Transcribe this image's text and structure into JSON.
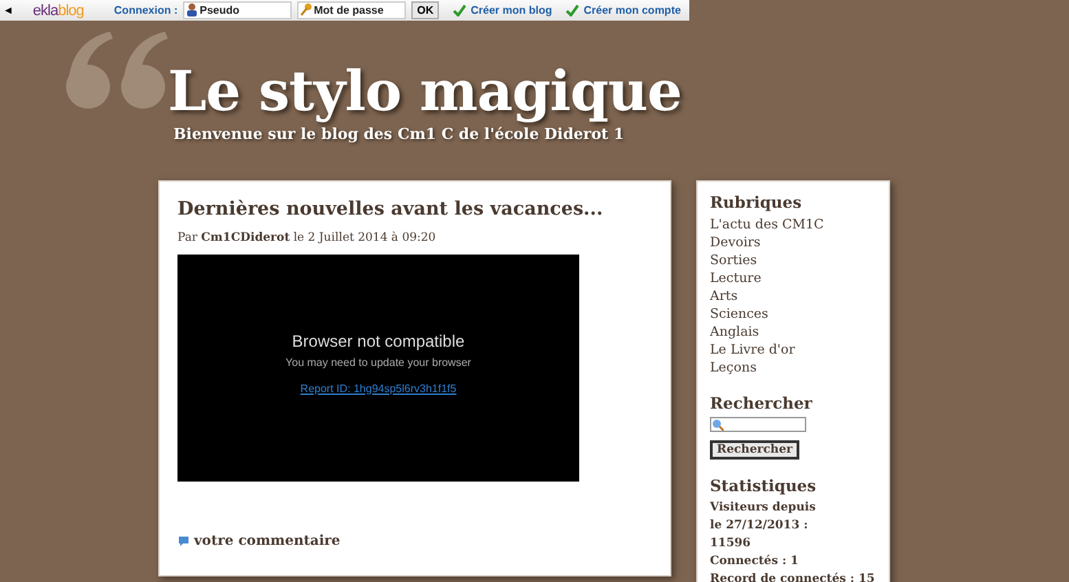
{
  "topbar": {
    "back": "◄",
    "logo": [
      "ekla",
      "blog"
    ],
    "login_label": "Connexion :",
    "pseudo": {
      "placeholder": "Pseudo"
    },
    "password": {
      "placeholder": "Mot de passe"
    },
    "ok": "OK",
    "links": [
      "Créer mon blog",
      "Créer mon compte"
    ]
  },
  "header": {
    "title": "Le stylo magique",
    "subtitle": "Bienvenue sur le blog des Cm1 C de l'école Diderot 1"
  },
  "post": {
    "title": "Dernières nouvelles avant les vacances...",
    "by": "Par",
    "author": "Cm1CDiderot",
    "date": "le 2 Juillet 2014 à 09:20",
    "video": {
      "heading": "Browser not compatible",
      "message": "You may need to update your browser",
      "report": "Report ID: 1hg94sp5l6rv3h1f1f5"
    },
    "comment": "votre commentaire"
  },
  "sidebar": {
    "rubriques": {
      "title": "Rubriques",
      "items": [
        "L'actu des CM1C",
        "Devoirs",
        "Sorties",
        "Lecture",
        "Arts",
        "Sciences",
        "Anglais",
        "Le Livre d'or",
        "Leçons"
      ]
    },
    "search": {
      "title": "Rechercher",
      "button": "Rechercher"
    },
    "stats": {
      "title": "Statistiques",
      "lines": [
        "Visiteurs depuis le 27/12/2013 : 11596",
        "Connectés : 1",
        "Record de connectés : 15"
      ]
    }
  }
}
